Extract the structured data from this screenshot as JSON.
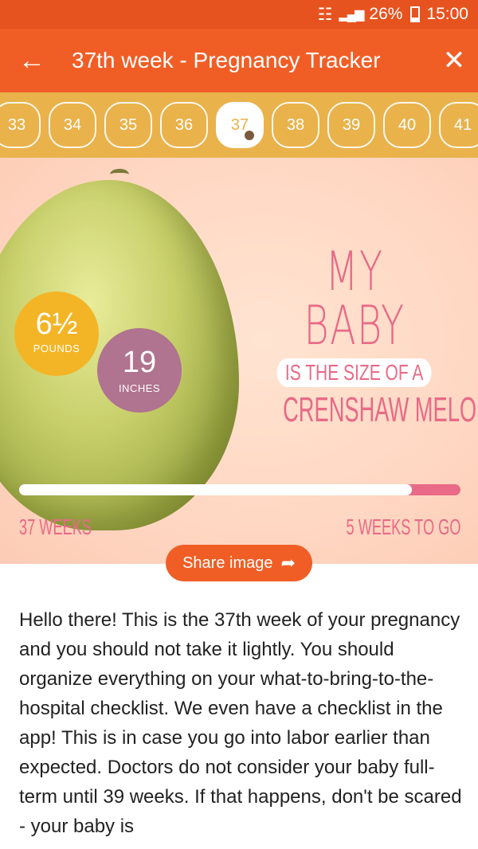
{
  "status_bar": {
    "battery": "26%",
    "time": "15:00"
  },
  "app_bar": {
    "title": "37th week - Pregnancy Tracker"
  },
  "weeks": [
    "33",
    "34",
    "35",
    "36",
    "37",
    "38",
    "39",
    "40",
    "41"
  ],
  "active_week": "37",
  "hero": {
    "weight_value": "6½",
    "weight_unit": "POUNDS",
    "length_value": "19",
    "length_unit": "INCHES",
    "line1": "MY BABY",
    "line2": "IS THE SIZE OF A",
    "line3": "CRENSHAW MELON",
    "weeks_done": "37 WEEKS",
    "weeks_left": "5 WEEKS TO GO",
    "progress_fraction": 0.89
  },
  "share_label": "Share image",
  "body_text": "Hello there! This is the 37th week of your pregnancy and you should not take it lightly. You should organize everything on your what-to-bring-to-the-hospital checklist. We even have a checklist in the app! This is in case you go into labor earlier than expected. Doctors do not consider your baby full-term until 39 weeks. If that happens, don't be scared - your baby is",
  "colors": {
    "app_bar": "#f05e26",
    "status_bar": "#e7531f",
    "week_strip": "#e9b24b",
    "accent_pink": "#e86a86",
    "weight_circle": "#f3b526",
    "length_circle": "#b07390"
  }
}
